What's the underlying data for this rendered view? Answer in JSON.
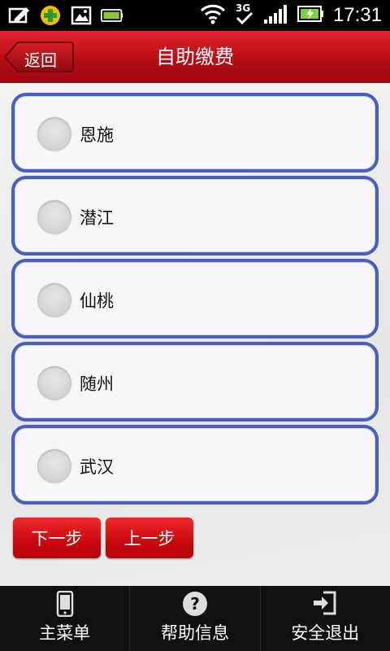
{
  "status": {
    "time": "17:31",
    "network": "3G"
  },
  "header": {
    "back_label": "返回",
    "title": "自助缴费"
  },
  "options": [
    {
      "label": "恩施"
    },
    {
      "label": "潜江"
    },
    {
      "label": "仙桃"
    },
    {
      "label": "随州"
    },
    {
      "label": "武汉"
    }
  ],
  "actions": {
    "next_label": "下一步",
    "prev_label": "上一步"
  },
  "nav": [
    {
      "label": "主菜单",
      "icon": "phone-icon"
    },
    {
      "label": "帮助信息",
      "icon": "help-icon"
    },
    {
      "label": "安全退出",
      "icon": "logout-icon"
    }
  ],
  "colors": {
    "accent": "#c8080e",
    "option_border": "#4a5fb8"
  }
}
